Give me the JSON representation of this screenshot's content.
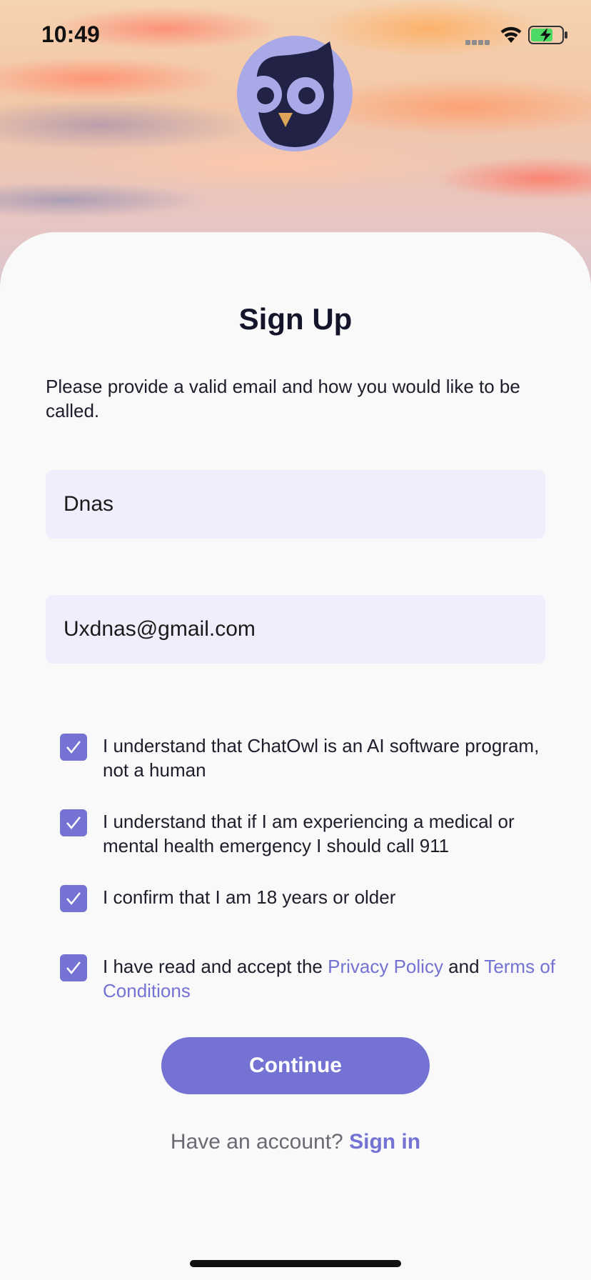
{
  "status_bar": {
    "time": "10:49"
  },
  "header": {
    "title": "Sign Up",
    "subtitle": "Please provide a valid email and how you would like to be called."
  },
  "form": {
    "name_value": "Dnas",
    "email_value": "Uxdnas@gmail.com"
  },
  "agreements": [
    {
      "text": "I understand that ChatOwl is an AI software program, not a human",
      "checked": true
    },
    {
      "text": "I understand that if I am experiencing a medical or mental health emergency I should call 911",
      "checked": true
    },
    {
      "text": "I confirm that I am 18 years or older",
      "checked": true
    },
    {
      "text_before": "I have read and accept the ",
      "privacy_link": "Privacy Policy",
      "text_middle": " and ",
      "terms_link": "Terms of Conditions",
      "checked": true
    }
  ],
  "continue_label": "Continue",
  "footer": {
    "prompt": "Have an account?",
    "signin_label": "Sign in"
  },
  "icons": {
    "logo": "owl-logo-icon",
    "checkbox": "checkmark-icon",
    "wifi": "wifi-icon",
    "battery": "battery-charging-icon"
  },
  "colors": {
    "accent": "#7472d2",
    "field_bg": "#eeeefc",
    "owl_body": "#222247",
    "owl_bg": "#a9a9e8",
    "owl_beak": "#e0a458"
  }
}
